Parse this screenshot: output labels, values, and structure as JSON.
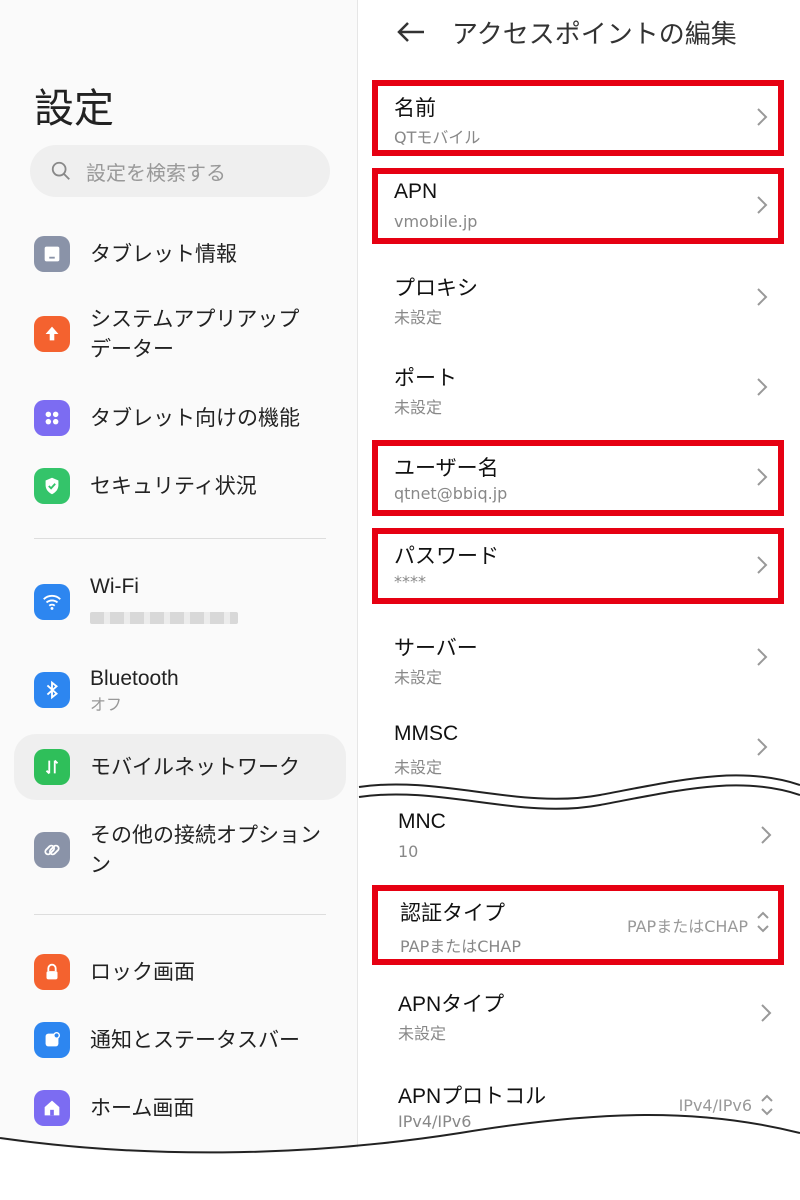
{
  "settings": {
    "title": "設定",
    "search_placeholder": "設定を検索する",
    "items": [
      {
        "label": "タブレット情報",
        "icon": "tablet-icon",
        "color": "#8a93a8"
      },
      {
        "label": "システムアプリアップ",
        "label2": "データー",
        "icon": "upload-arrow-icon",
        "color": "#f4622f"
      },
      {
        "label": "タブレット向けの機能",
        "icon": "grid-dots-icon",
        "color": "#7c6cf2"
      },
      {
        "label": "セキュリティ状況",
        "icon": "shield-check-icon",
        "color": "#34c46a"
      },
      {
        "label": "Wi-Fi",
        "icon": "wifi-icon",
        "color": "#2d86f0"
      },
      {
        "label": "Bluetooth",
        "sub": "オフ",
        "icon": "bluetooth-icon",
        "color": "#2d86f0"
      },
      {
        "label": "モバイルネットワーク",
        "icon": "mobile-data-icon",
        "color": "#2fbf5a"
      },
      {
        "label": "その他の接続オプション",
        "label2": "ン",
        "icon": "link-icon",
        "color": "#8a93a8"
      },
      {
        "label": "ロック画面",
        "icon": "lock-icon",
        "color": "#f4622f"
      },
      {
        "label": "通知とステータスバー",
        "icon": "notification-icon",
        "color": "#2d86f0"
      },
      {
        "label": "ホーム画面",
        "icon": "home-icon",
        "color": "#7c6cf2"
      }
    ]
  },
  "apn": {
    "title": "アクセスポイントの編集",
    "rows": [
      {
        "label": "名前",
        "value": "QTモバイル"
      },
      {
        "label": "APN",
        "value": "vmobile.jp"
      },
      {
        "label": "プロキシ",
        "value": "未設定"
      },
      {
        "label": "ポート",
        "value": "未設定"
      },
      {
        "label": "ユーザー名",
        "value": "qtnet@bbiq.jp"
      },
      {
        "label": "パスワード",
        "value": "****"
      },
      {
        "label": "サーバー",
        "value": "未設定"
      },
      {
        "label": "MMSC",
        "value": "未設定"
      },
      {
        "label": "MNC",
        "value": "10"
      },
      {
        "label": "認証タイプ",
        "value": "PAPまたはCHAP",
        "selected": "PAPまたはCHAP"
      },
      {
        "label": "APNタイプ",
        "value": "未設定"
      },
      {
        "label": "APNプロトコル",
        "value": "IPv4/IPv6",
        "selected": "IPv4/IPv6"
      }
    ]
  },
  "colors": {
    "highlight": "#e60012"
  }
}
